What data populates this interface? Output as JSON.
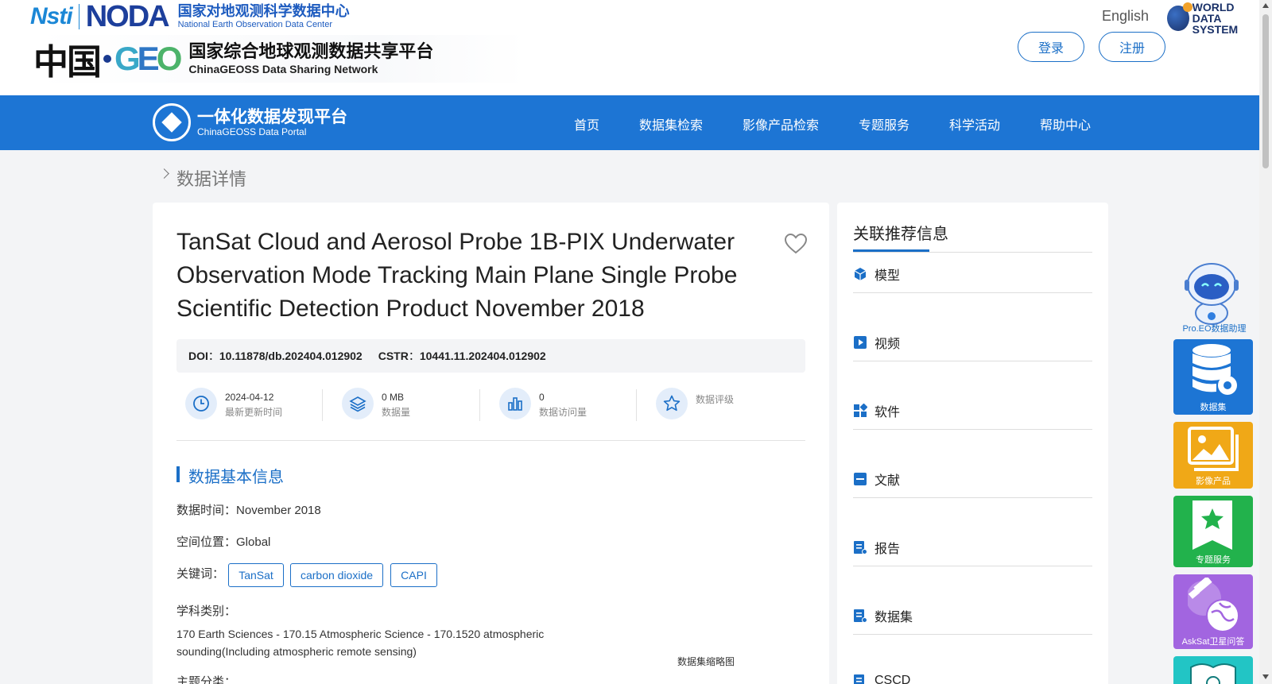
{
  "header": {
    "nsti_logo": "Nsti",
    "noda_logo": "NODA",
    "noda_cn": "国家对地观测科学数据中心",
    "noda_en": "National Earth Observation Data Center",
    "china_logo": "中国",
    "geo_logo": [
      "G",
      "E",
      "O"
    ],
    "geo_cn": "国家综合地球观测数据共享平台",
    "geo_en": "ChinaGEOSS Data Sharing Network",
    "language": "English",
    "wds_line1": "WORLD",
    "wds_line2": "DATA SYSTEM",
    "login": "登录",
    "register": "注册"
  },
  "nav": {
    "portal_cn": "一体化数据发现平台",
    "portal_en": "ChinaGEOSS Data Portal",
    "items": [
      "首页",
      "数据集检索",
      "影像产品检索",
      "专题服务",
      "科学活动",
      "帮助中心"
    ],
    "bg_color": "#1d75d4"
  },
  "breadcrumb": "数据详情",
  "dataset": {
    "title": "TanSat Cloud and Aerosol Probe 1B-PIX Underwater Observation Mode Tracking Main Plane Single Probe Scientific Detection Product November 2018",
    "doi_label": "DOI",
    "doi_value": "10.11878/db.202404.012902",
    "cstr_label": "CSTR",
    "cstr_value": "10441.11.202404.012902",
    "colon": "：",
    "stats": [
      {
        "value": "2024-04-12",
        "label": "最新更新时间",
        "icon": "clock-icon"
      },
      {
        "value": "0 MB",
        "label": "数据量",
        "icon": "layers-icon"
      },
      {
        "value": "0",
        "label": "数据访问量",
        "icon": "bar-chart-icon"
      },
      {
        "value": "",
        "label": "数据评级",
        "icon": "star-icon"
      }
    ],
    "section_title": "数据基本信息",
    "time_label": "数据时间：",
    "time_value": "November 2018",
    "space_label": "空间位置：",
    "space_value": "Global",
    "keywords_label": "关键词：",
    "keywords": [
      "TanSat",
      "carbon dioxide",
      "CAPI"
    ],
    "subject_label": "学科类别：",
    "subject_value": "170 Earth Sciences - 170.15 Atmospheric Science - 170.1520 atmospheric sounding(Including atmospheric remote sensing)",
    "theme_label": "主题分类：",
    "thumbnail_label": "数据集缩略图"
  },
  "sidebar": {
    "title": "关联推荐信息",
    "items": [
      {
        "label": "模型",
        "icon": "cube-icon"
      },
      {
        "label": "视频",
        "icon": "play-icon"
      },
      {
        "label": "软件",
        "icon": "apps-icon"
      },
      {
        "label": "文献",
        "icon": "document-icon"
      },
      {
        "label": "报告",
        "icon": "report-icon"
      },
      {
        "label": "数据集",
        "icon": "dataset-icon"
      },
      {
        "label": "CSCD",
        "icon": "cscd-icon"
      }
    ]
  },
  "tools": {
    "assistant_label": "Pro.EO数据助理",
    "items": [
      {
        "label": "数据集",
        "color": "#1d75d4",
        "icon": "database-gear-icon"
      },
      {
        "label": "影像产品",
        "color": "#f0a817",
        "icon": "image-icon"
      },
      {
        "label": "专题服务",
        "color": "#22b24c",
        "icon": "bookmark-star-icon"
      },
      {
        "label": "AskSat卫星问答",
        "color": "#a265e0",
        "icon": "satellite-icon"
      },
      {
        "label": "",
        "color": "#22c5c5",
        "icon": "book-icon"
      }
    ]
  }
}
